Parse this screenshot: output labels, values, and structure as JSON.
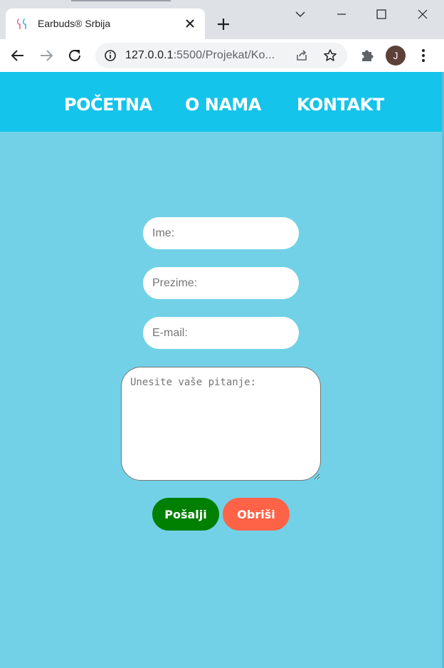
{
  "browser": {
    "tab_title": "Earbuds® Srbija",
    "url_host": "127.0.0.1",
    "url_rest": ":5500/Projekat/Ko...",
    "profile_initial": "J"
  },
  "nav": {
    "items": [
      {
        "label": "POČETNA"
      },
      {
        "label": "O NAMA"
      },
      {
        "label": "KONTAKT"
      }
    ]
  },
  "form": {
    "name_placeholder": "Ime:",
    "surname_placeholder": "Prezime:",
    "email_placeholder": "E-mail:",
    "question_placeholder": "Unesite vaše pitanje:",
    "send_label": "Pošalji",
    "clear_label": "Obriši"
  },
  "colors": {
    "page_bg": "#72d1e7",
    "nav_bg": "#14c4ea",
    "send_button": "#008000",
    "clear_button": "#ff6347"
  },
  "icons": [
    "earbuds-favicon-icon",
    "close-icon",
    "plus-icon",
    "chevron-down-icon",
    "minimize-icon",
    "maximize-icon",
    "window-close-icon",
    "back-arrow-icon",
    "forward-arrow-icon",
    "reload-icon",
    "info-icon",
    "share-icon",
    "star-icon",
    "extensions-puzzle-icon",
    "kebab-menu-icon"
  ]
}
